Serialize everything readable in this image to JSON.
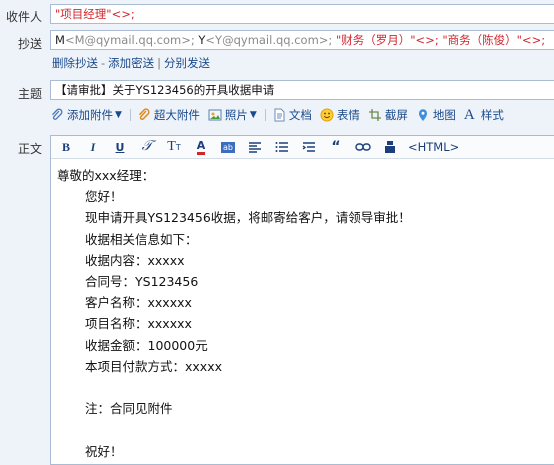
{
  "labels": {
    "to": "收件人",
    "cc": "抄送",
    "subject": "主题",
    "body": "正文"
  },
  "to_value": "\"项目经理\"<>;",
  "cc": {
    "c1_name": "M",
    "c1_addr": "<M@qymail.qq.com>;",
    "c2_name": "Y",
    "c2_addr": "<Y@qymail.qq.com>;",
    "c3": "\"财务（罗月）\"<>;",
    "c4": "\"商务（陈俊）\"<>;"
  },
  "cc_links": [
    "删除抄送",
    "添加密送",
    "分别发送"
  ],
  "cc_sep1": "-",
  "cc_sep2": "|",
  "subject_value": "【请审批】关于YS123456的开具收据申请",
  "toolbar": {
    "attach": "添加附件",
    "big_attach": "超大附件",
    "photo": "照片",
    "doc": "文档",
    "emoji": "表情",
    "screenshot": "截屏",
    "map": "地图",
    "style": "样式"
  },
  "format_html": "<HTML>",
  "body_lines": [
    "尊敬的xxx经理：",
    "您好！",
    "现申请开具YS123456收据，将邮寄给客户，请领导审批！",
    "收据相关信息如下：",
    "收据内容：xxxxx",
    "合同号：YS123456",
    "客户名称：xxxxxx",
    "项目名称：xxxxxx",
    "收据金额：100000元",
    "本项目付款方式：xxxxx",
    "注：合同见附件",
    "祝好！"
  ],
  "colors": {
    "link": "#1a4a8c",
    "red": "#d0262e",
    "border": "#a9bcd3",
    "bg": "#eef3f9"
  }
}
